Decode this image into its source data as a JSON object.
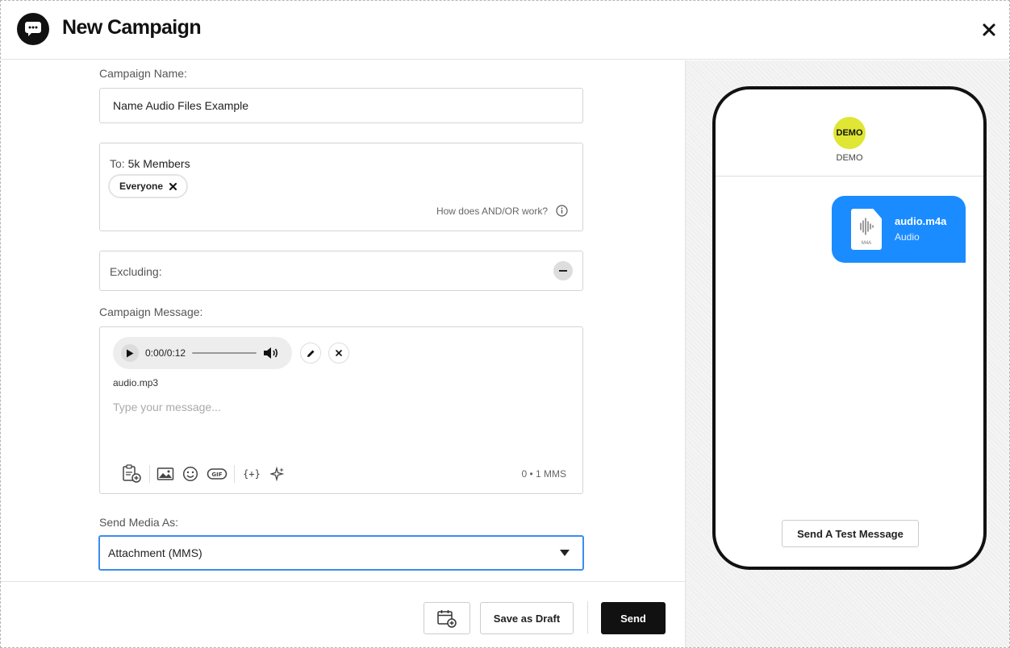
{
  "header": {
    "title": "New Campaign"
  },
  "campaign_name": {
    "label": "Campaign Name:",
    "value": "Name Audio Files Example"
  },
  "recipients": {
    "to_prefix": "To:",
    "count": "5k Members",
    "chips": [
      {
        "label": "Everyone"
      }
    ],
    "help_text": "How does AND/OR work?"
  },
  "excluding": {
    "label": "Excluding:"
  },
  "message": {
    "label": "Campaign Message:",
    "audio_time": "0:00/0:12",
    "file_name": "audio.mp3",
    "placeholder": "Type your message...",
    "counter": "0 • 1 MMS",
    "toolbar_icons": [
      "clipboard-add-icon",
      "image-icon",
      "emoji-icon",
      "gif-icon",
      "variable-icon",
      "sparkle-icon"
    ]
  },
  "send_media": {
    "label": "Send Media As:",
    "selected": "Attachment (MMS)"
  },
  "footer": {
    "save_draft": "Save as Draft",
    "send": "Send"
  },
  "preview": {
    "avatar_text": "DEMO",
    "avatar_name": "DEMO",
    "attachment_title": "audio.m4a",
    "attachment_sub": "Audio",
    "file_ext": "M4A",
    "test_button": "Send A Test Message"
  },
  "colors": {
    "accent": "#3b8cf0",
    "bubble": "#1a8cff",
    "avatar": "#dfe633",
    "primary_button": "#111111"
  }
}
